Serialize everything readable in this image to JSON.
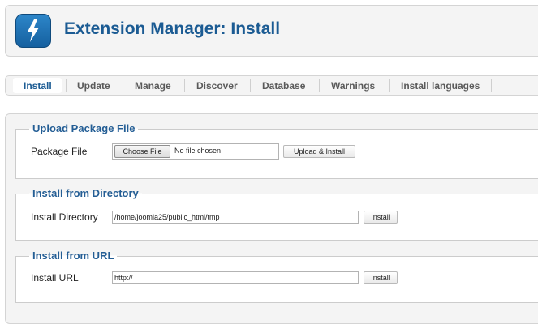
{
  "header": {
    "title": "Extension Manager: Install",
    "logo_icon": "lightning-bolt-icon"
  },
  "tabs": [
    {
      "label": "Install",
      "active": true
    },
    {
      "label": "Update",
      "active": false
    },
    {
      "label": "Manage",
      "active": false
    },
    {
      "label": "Discover",
      "active": false
    },
    {
      "label": "Database",
      "active": false
    },
    {
      "label": "Warnings",
      "active": false
    },
    {
      "label": "Install languages",
      "active": false
    }
  ],
  "upload": {
    "legend": "Upload Package File",
    "label": "Package File",
    "choose_button": "Choose File",
    "file_status": "No file chosen",
    "submit_button": "Upload & Install"
  },
  "directory": {
    "legend": "Install from Directory",
    "label": "Install Directory",
    "value": "/home/joomla25/public_html/tmp",
    "submit_button": "Install"
  },
  "url": {
    "legend": "Install from URL",
    "label": "Install URL",
    "value": "http://",
    "submit_button": "Install"
  },
  "colors": {
    "title": "#1b5b93",
    "logo": "#1f74b6",
    "legend": "#245e95",
    "panel_bg": "#f4f4f4"
  }
}
